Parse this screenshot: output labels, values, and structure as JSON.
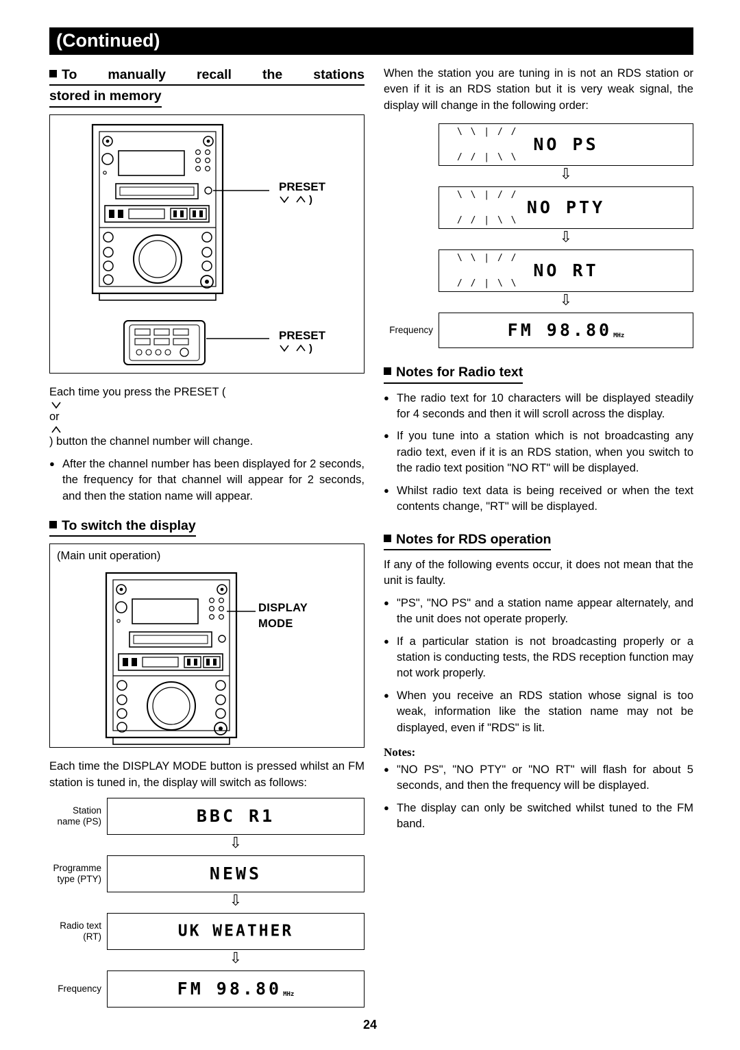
{
  "header": {
    "title": "(Continued)"
  },
  "page_number": "24",
  "left": {
    "section1": {
      "heading_line1": "To manually recall the stations",
      "heading_line2": "stored in memory",
      "callout_top": "PRESET",
      "callout_bottom": "PRESET",
      "body": "Each time you press the PRESET (  or  ) button the channel number will change.",
      "bullet1": "After the channel number has been displayed for 2 seconds, the frequency for that channel will appear for 2 seconds, and then the station name will appear."
    },
    "section2": {
      "heading": "To switch the display",
      "figure_caption": "(Main unit operation)",
      "callout_line1": "DISPLAY",
      "callout_line2": "MODE",
      "body": "Each time the DISPLAY MODE button is pressed whilst an FM station is tuned in, the display will switch as follows:",
      "steps": [
        {
          "label_line1": "Station",
          "label_line2": "name (PS)",
          "display": "BBC R1",
          "mhz": ""
        },
        {
          "label_line1": "Programme",
          "label_line2": "type (PTY)",
          "display": "NEWS",
          "mhz": ""
        },
        {
          "label_line1": "Radio text",
          "label_line2": "(RT)",
          "display": "UK WEATHER",
          "mhz": ""
        },
        {
          "label_line1": "Frequency",
          "label_line2": "",
          "display": "FM   98.80",
          "mhz": "MHz"
        }
      ]
    }
  },
  "right": {
    "intro": "When the station you are tuning in is not an RDS station or even if it is an RDS station but it is very weak signal, the display will change in the following order:",
    "steps": [
      {
        "label": "",
        "display": "NO PS",
        "mhz": ""
      },
      {
        "label": "",
        "display": "NO PTY",
        "mhz": ""
      },
      {
        "label": "",
        "display": "NO RT",
        "mhz": ""
      },
      {
        "label": "Frequency",
        "display": "FM    98.80",
        "mhz": "MHz"
      }
    ],
    "section_radiotext": {
      "heading": "Notes for Radio text",
      "bullets": [
        "The radio text for 10 characters will be displayed steadily for 4 seconds and then it will scroll across the display.",
        "If you tune into a station which is not broadcasting any radio text, even if it is an RDS station, when you switch to the radio text position \"NO RT\" will be displayed.",
        "Whilst radio text data is being received or when the text contents change, \"RT\" will be displayed."
      ]
    },
    "section_rds": {
      "heading": "Notes for RDS operation",
      "body": "If any of the following events occur, it does not mean that the unit is faulty.",
      "bullets": [
        "\"PS\", \"NO PS\" and a station name appear alternately, and the unit does not operate properly.",
        "If a particular station is not broadcasting properly or a station is conducting tests, the RDS reception function may not work properly.",
        "When you receive an RDS station whose signal is too weak, information like the station name may not be displayed, even if \"RDS\" is lit."
      ],
      "notes_heading": "Notes:",
      "notes": [
        "\"NO PS\", \"NO PTY\" or \"NO RT\" will flash for about 5 seconds, and then the frequency will be displayed.",
        "The display can only be switched whilst tuned to the FM band."
      ]
    }
  }
}
